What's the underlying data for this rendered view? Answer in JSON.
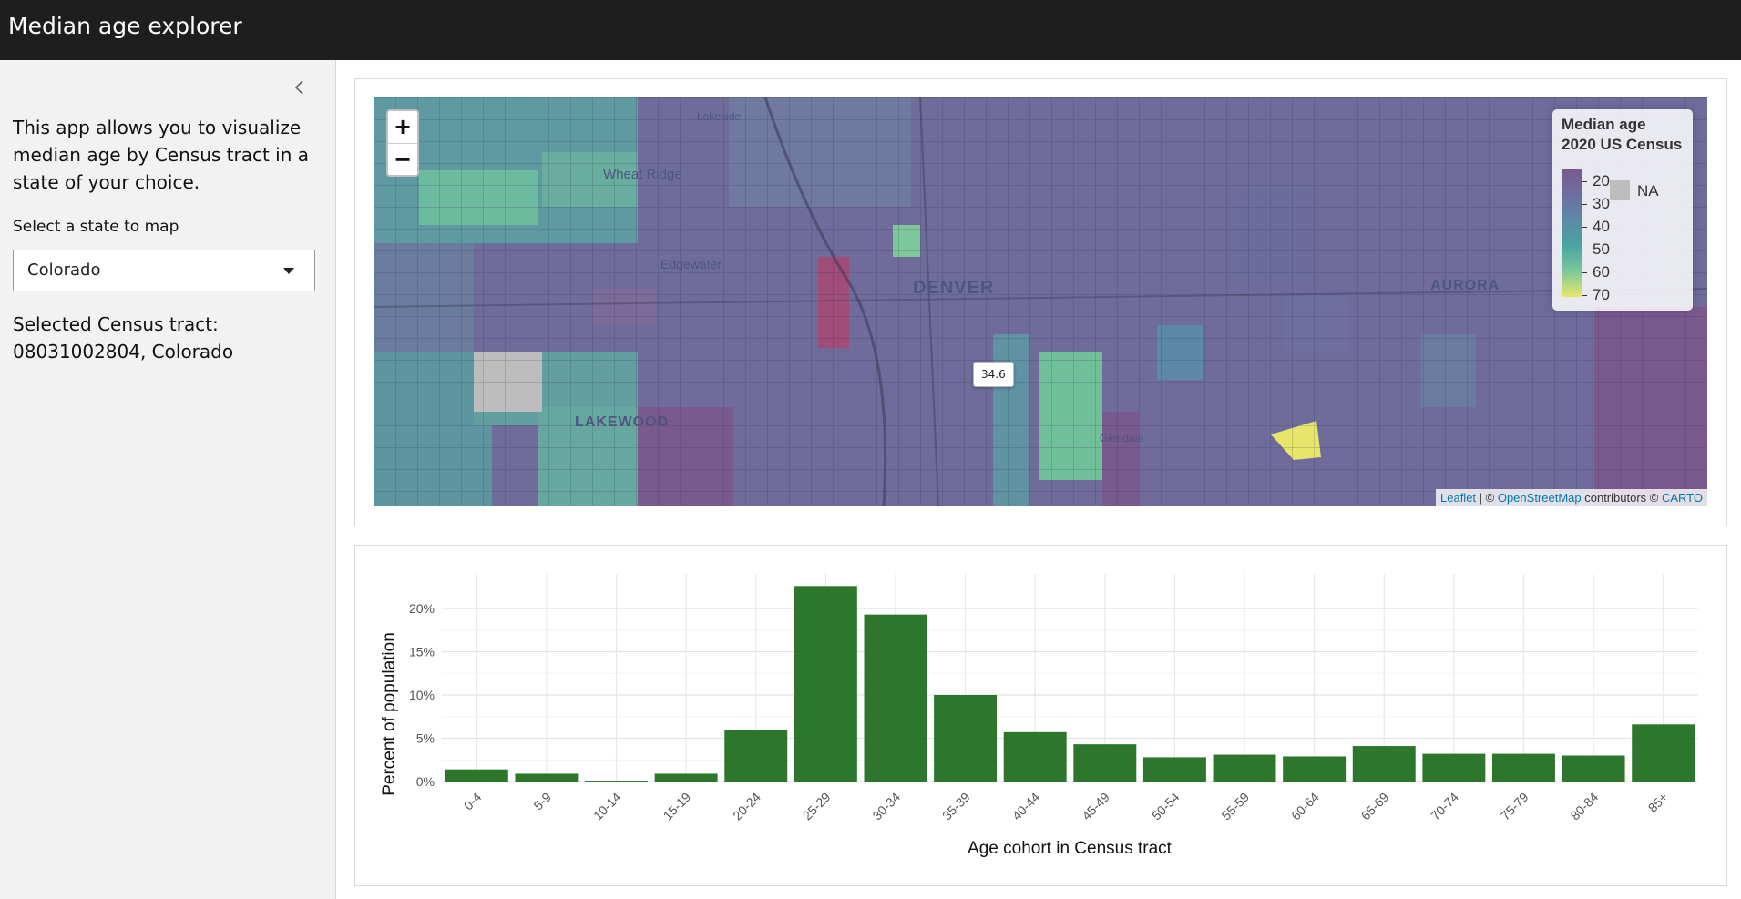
{
  "app": {
    "title": "Median age explorer"
  },
  "sidebar": {
    "intro": "This app allows you to visualize median age by Census tract in a state of your choice.",
    "state_label": "Select a state to map",
    "state_value": "Colorado",
    "tract_label": "Selected Census tract:",
    "tract_value": "08031002804, Colorado"
  },
  "map": {
    "zoom_in": "+",
    "zoom_out": "−",
    "place_labels": [
      "Lakeside",
      "Wheat Ridge",
      "Edgewater",
      "DENVER",
      "AURORA",
      "LAKEWOOD",
      "Glendale"
    ],
    "tooltip": "34.6",
    "legend": {
      "title_line1": "Median age",
      "title_line2": "2020 US Census",
      "breaks": [
        "20",
        "30",
        "40",
        "50",
        "60",
        "70"
      ],
      "na_label": "NA",
      "colors": [
        "#7a5a8e",
        "#6e6fa0",
        "#5c8aa6",
        "#4aa5a3",
        "#7cc89a",
        "#e8e66a"
      ]
    },
    "attribution": {
      "leaflet": "Leaflet",
      "sep": " | © ",
      "osm": "OpenStreetMap",
      "contrib": " contributors © ",
      "carto": "CARTO"
    }
  },
  "chart_data": {
    "type": "bar",
    "categories": [
      "0-4",
      "5-9",
      "10-14",
      "15-19",
      "20-24",
      "25-29",
      "30-34",
      "35-39",
      "40-44",
      "45-49",
      "50-54",
      "55-59",
      "60-64",
      "65-69",
      "70-74",
      "75-79",
      "80-84",
      "85+"
    ],
    "values": [
      1.4,
      0.9,
      0.1,
      0.9,
      5.9,
      22.6,
      19.3,
      10.0,
      5.7,
      4.3,
      2.8,
      3.1,
      2.9,
      4.1,
      3.2,
      3.2,
      3.0,
      6.6
    ],
    "xlabel": "Age cohort in Census tract",
    "ylabel": "Percent of population",
    "ylim": [
      0,
      24
    ],
    "yticks": [
      "0%",
      "5%",
      "10%",
      "15%",
      "20%"
    ],
    "bar_color": "#1a6b1a",
    "grid": true
  }
}
